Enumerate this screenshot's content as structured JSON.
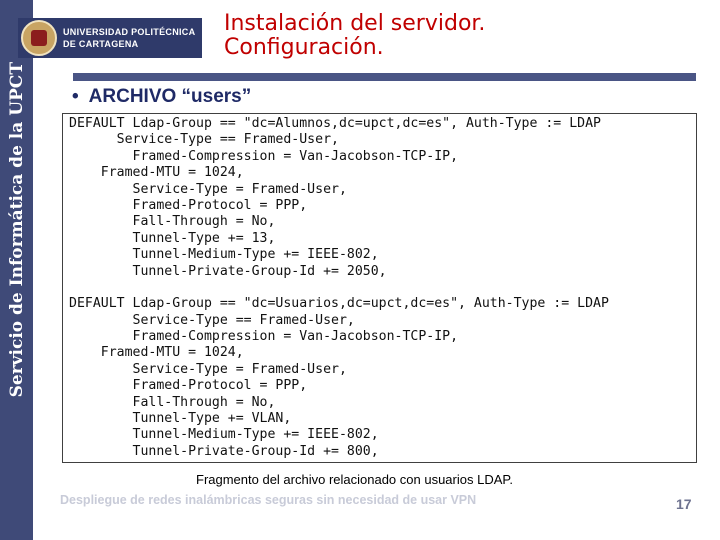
{
  "sidebar": {
    "text": "Servicio de Informática de la UPCT"
  },
  "logo": {
    "line1": "UNIVERSIDAD POLITÉCNICA",
    "line2": "DE CARTAGENA"
  },
  "header": {
    "title_line1": "Instalación del servidor.",
    "title_line2": "Configuración."
  },
  "bullet": {
    "symbol": "•",
    "text": "ARCHIVO “users”"
  },
  "code": {
    "lines": [
      "DEFAULT Ldap-Group == \"dc=Alumnos,dc=upct,dc=es\", Auth-Type := LDAP",
      "      Service-Type == Framed-User,",
      "        Framed-Compression = Van-Jacobson-TCP-IP,",
      "    Framed-MTU = 1024,",
      "        Service-Type = Framed-User,",
      "        Framed-Protocol = PPP,",
      "        Fall-Through = No,",
      "        Tunnel-Type += 13,",
      "        Tunnel-Medium-Type += IEEE-802,",
      "        Tunnel-Private-Group-Id += 2050,",
      "",
      "DEFAULT Ldap-Group == \"dc=Usuarios,dc=upct,dc=es\", Auth-Type := LDAP",
      "        Service-Type == Framed-User,",
      "        Framed-Compression = Van-Jacobson-TCP-IP,",
      "    Framed-MTU = 1024,",
      "        Service-Type = Framed-User,",
      "        Framed-Protocol = PPP,",
      "        Fall-Through = No,",
      "        Tunnel-Type += VLAN,",
      "        Tunnel-Medium-Type += IEEE-802,",
      "        Tunnel-Private-Group-Id += 800,"
    ]
  },
  "caption": "Fragmento del archivo relacionado con usuarios LDAP.",
  "footer": {
    "text": "Despliegue de redes inalámbricas seguras sin necesidad de usar VPN",
    "page_number": "17"
  },
  "colors": {
    "sidebar": "#3f4a78",
    "title": "#c00000",
    "bullet": "#1f2a66",
    "rule": "#4a5585"
  }
}
